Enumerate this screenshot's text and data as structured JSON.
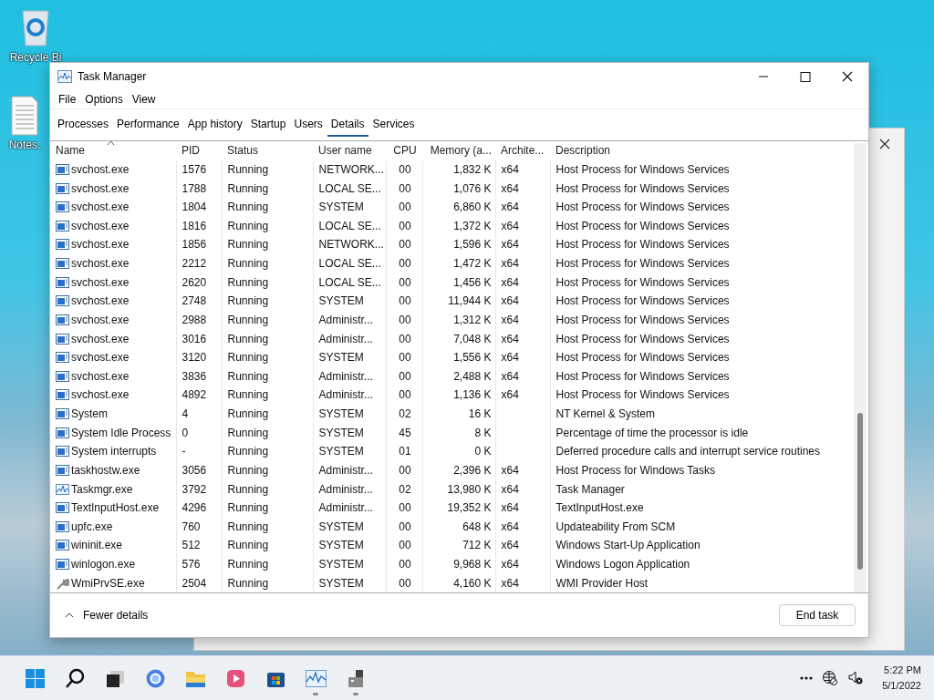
{
  "desktop_icons": [
    {
      "kind": "recycle",
      "label": "Recycle Bi"
    },
    {
      "kind": "document",
      "label": "Notes."
    }
  ],
  "window": {
    "title": "Task Manager"
  },
  "menu": [
    "File",
    "Options",
    "View"
  ],
  "tabs": [
    {
      "label": "Processes",
      "selected": false
    },
    {
      "label": "Performance",
      "selected": false
    },
    {
      "label": "App history",
      "selected": false
    },
    {
      "label": "Startup",
      "selected": false
    },
    {
      "label": "Users",
      "selected": false
    },
    {
      "label": "Details",
      "selected": true
    },
    {
      "label": "Services",
      "selected": false
    }
  ],
  "table": {
    "columns": [
      "Name",
      "PID",
      "Status",
      "User name",
      "CPU",
      "Memory (a...",
      "Archite...",
      "Description"
    ],
    "rows": [
      {
        "kind": "service",
        "cells": [
          "svchost.exe",
          "1576",
          "Running",
          "NETWORK...",
          "00",
          "1,832 K",
          "x64",
          "Host Process for Windows Services"
        ]
      },
      {
        "kind": "service",
        "cells": [
          "svchost.exe",
          "1788",
          "Running",
          "LOCAL SE...",
          "00",
          "1,076 K",
          "x64",
          "Host Process for Windows Services"
        ]
      },
      {
        "kind": "service",
        "cells": [
          "svchost.exe",
          "1804",
          "Running",
          "SYSTEM",
          "00",
          "6,860 K",
          "x64",
          "Host Process for Windows Services"
        ]
      },
      {
        "kind": "service",
        "cells": [
          "svchost.exe",
          "1816",
          "Running",
          "LOCAL SE...",
          "00",
          "1,372 K",
          "x64",
          "Host Process for Windows Services"
        ]
      },
      {
        "kind": "service",
        "cells": [
          "svchost.exe",
          "1856",
          "Running",
          "NETWORK...",
          "00",
          "1,596 K",
          "x64",
          "Host Process for Windows Services"
        ]
      },
      {
        "kind": "service",
        "cells": [
          "svchost.exe",
          "2212",
          "Running",
          "LOCAL SE...",
          "00",
          "1,472 K",
          "x64",
          "Host Process for Windows Services"
        ]
      },
      {
        "kind": "service",
        "cells": [
          "svchost.exe",
          "2620",
          "Running",
          "LOCAL SE...",
          "00",
          "1,456 K",
          "x64",
          "Host Process for Windows Services"
        ]
      },
      {
        "kind": "service",
        "cells": [
          "svchost.exe",
          "2748",
          "Running",
          "SYSTEM",
          "00",
          "11,944 K",
          "x64",
          "Host Process for Windows Services"
        ]
      },
      {
        "kind": "service",
        "cells": [
          "svchost.exe",
          "2988",
          "Running",
          "Administr...",
          "00",
          "1,312 K",
          "x64",
          "Host Process for Windows Services"
        ]
      },
      {
        "kind": "service",
        "cells": [
          "svchost.exe",
          "3016",
          "Running",
          "Administr...",
          "00",
          "7,048 K",
          "x64",
          "Host Process for Windows Services"
        ]
      },
      {
        "kind": "service",
        "cells": [
          "svchost.exe",
          "3120",
          "Running",
          "SYSTEM",
          "00",
          "1,556 K",
          "x64",
          "Host Process for Windows Services"
        ]
      },
      {
        "kind": "service",
        "cells": [
          "svchost.exe",
          "3836",
          "Running",
          "Administr...",
          "00",
          "2,488 K",
          "x64",
          "Host Process for Windows Services"
        ]
      },
      {
        "kind": "service",
        "cells": [
          "svchost.exe",
          "4892",
          "Running",
          "Administr...",
          "00",
          "1,136 K",
          "x64",
          "Host Process for Windows Services"
        ]
      },
      {
        "kind": "service",
        "cells": [
          "System",
          "4",
          "Running",
          "SYSTEM",
          "02",
          "16 K",
          "",
          "NT Kernel & System"
        ]
      },
      {
        "kind": "service",
        "cells": [
          "System Idle Process",
          "0",
          "Running",
          "SYSTEM",
          "45",
          "8 K",
          "",
          "Percentage of time the processor is idle"
        ]
      },
      {
        "kind": "service",
        "cells": [
          "System interrupts",
          "-",
          "Running",
          "SYSTEM",
          "01",
          "0 K",
          "",
          "Deferred procedure calls and interrupt service routines"
        ]
      },
      {
        "kind": "service",
        "cells": [
          "taskhostw.exe",
          "3056",
          "Running",
          "Administr...",
          "00",
          "2,396 K",
          "x64",
          "Host Process for Windows Tasks"
        ]
      },
      {
        "kind": "chart",
        "cells": [
          "Taskmgr.exe",
          "3792",
          "Running",
          "Administr...",
          "02",
          "13,980 K",
          "x64",
          "Task Manager"
        ]
      },
      {
        "kind": "service",
        "cells": [
          "TextInputHost.exe",
          "4296",
          "Running",
          "Administr...",
          "00",
          "19,352 K",
          "x64",
          "TextInputHost.exe"
        ]
      },
      {
        "kind": "service",
        "cells": [
          "upfc.exe",
          "760",
          "Running",
          "SYSTEM",
          "00",
          "648 K",
          "x64",
          "Updateability From SCM"
        ]
      },
      {
        "kind": "service",
        "cells": [
          "wininit.exe",
          "512",
          "Running",
          "SYSTEM",
          "00",
          "712 K",
          "x64",
          "Windows Start-Up Application"
        ]
      },
      {
        "kind": "service",
        "cells": [
          "winlogon.exe",
          "576",
          "Running",
          "SYSTEM",
          "00",
          "9,968 K",
          "x64",
          "Windows Logon Application"
        ]
      },
      {
        "kind": "wrench",
        "cells": [
          "WmiPrvSE.exe",
          "2504",
          "Running",
          "SYSTEM",
          "00",
          "4,160 K",
          "x64",
          "WMI Provider Host"
        ]
      }
    ]
  },
  "footer": {
    "toggle": "Fewer details",
    "button": "End task"
  },
  "taskbar": {
    "apps": [
      {
        "kind": "start",
        "running": false
      },
      {
        "kind": "search",
        "running": false
      },
      {
        "kind": "taskview",
        "running": false
      },
      {
        "kind": "browser",
        "running": false
      },
      {
        "kind": "folder",
        "running": false
      },
      {
        "kind": "media",
        "running": false
      },
      {
        "kind": "store",
        "running": false
      },
      {
        "kind": "monitor",
        "running": true
      },
      {
        "kind": "device",
        "running": true
      }
    ],
    "time": "5:22 PM",
    "date": "5/1/2022"
  }
}
